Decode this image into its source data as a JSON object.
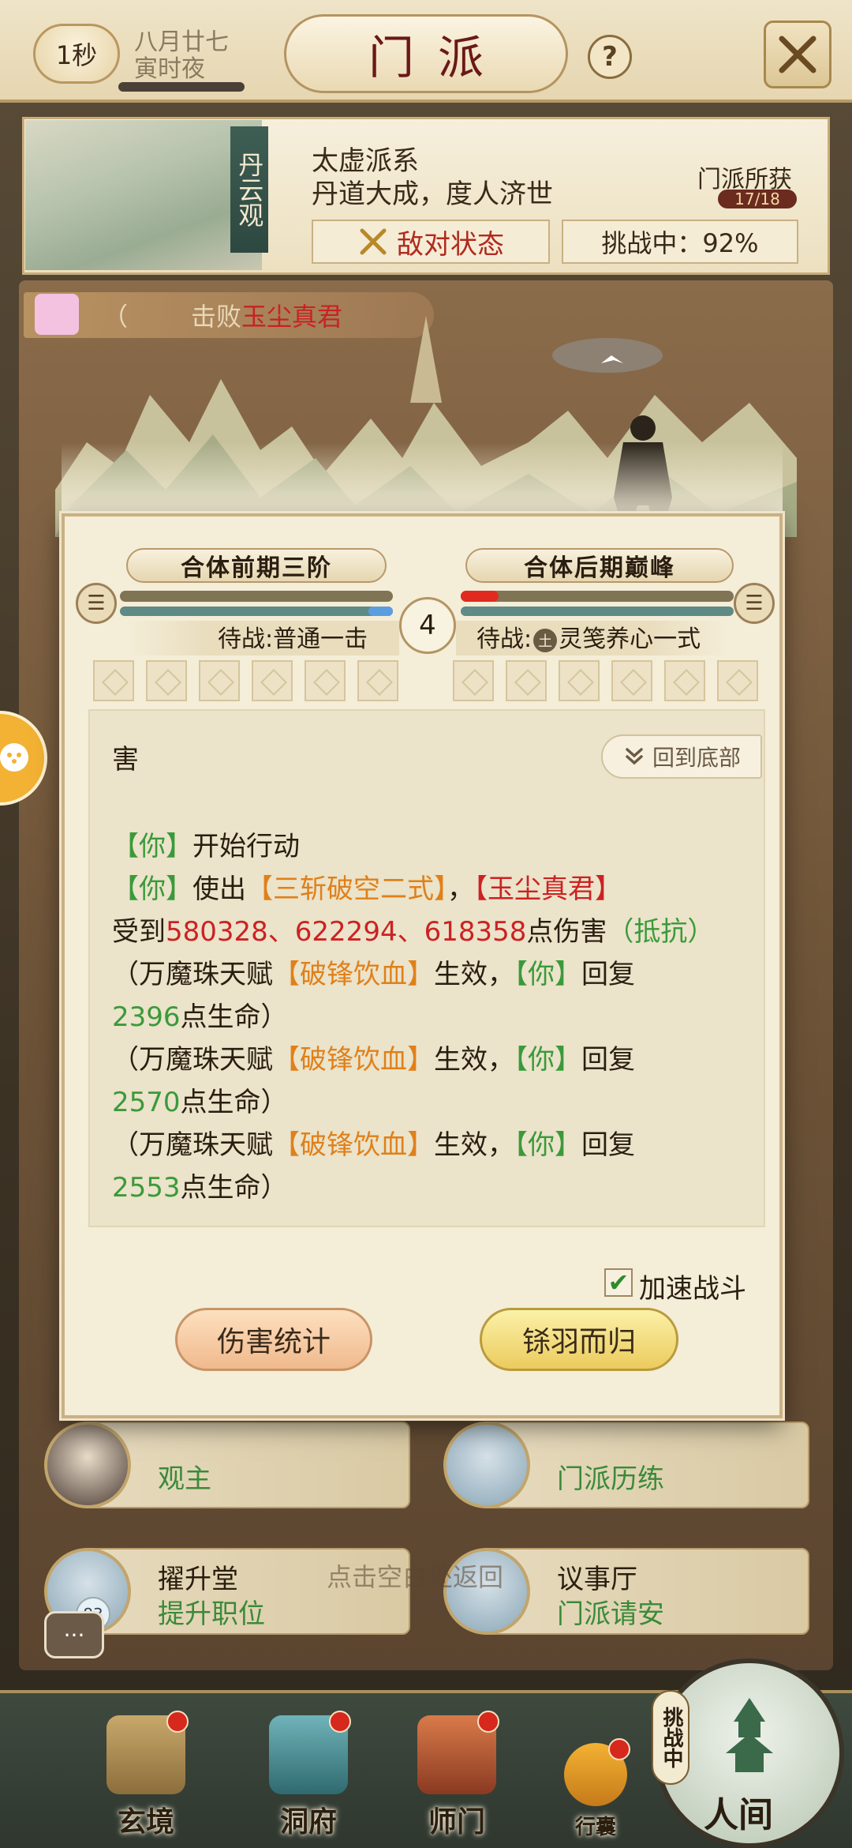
{
  "header": {
    "timer": "1秒",
    "date_line1": "八月廿七",
    "date_line2": "寅时夜",
    "title": "门派",
    "help": "?"
  },
  "sect": {
    "tag": "丹云观",
    "name": "太虚派系",
    "motto": "丹道大成，度人济世",
    "hostile_status": "敌对状态",
    "challenge_status": "挑战中：92%",
    "gain_label": "门派所获",
    "gain_progress": "17/18"
  },
  "defeat_banner": {
    "prefix": "（",
    "visible_mid": "击败",
    "boss": "玉尘真君"
  },
  "battle": {
    "left_realm": "合体前期三阶",
    "right_realm": "合体后期巅峰",
    "round": "4",
    "left_wait": "待战:普通一击",
    "right_wait_prefix": "待战:",
    "right_element": "土",
    "right_wait_skill": "灵笺养心一式",
    "back_to_bottom": "回到底部",
    "speed_label": "加速战斗",
    "speed_checked": true,
    "btn_damage_stats": "伤害统计",
    "btn_retreat": "铩羽而归",
    "hp_right_fraction": 0.14,
    "mp_left_fraction": 0.09
  },
  "log": {
    "line0": "害",
    "you": "【你】",
    "start_action": "开始行动",
    "use": "使出",
    "skill": "【三斩破空二式】",
    "comma": "，",
    "enemy": "【玉尘真君】",
    "received": "受到",
    "damages": "580328、622294、618358",
    "damage_suffix": "点伤害",
    "resist": "（抵抗）",
    "talent_prefix": "（万魔珠天赋",
    "talent": "【破锋饮血】",
    "talent_effect": "生效，",
    "recover": "回复",
    "heal1": "2396",
    "heal2": "2570",
    "heal3": "2553",
    "hp_suffix": "点生命）"
  },
  "buildings": [
    {
      "title": "",
      "subtitle": "观主"
    },
    {
      "title": "",
      "subtitle": "门派历练"
    },
    {
      "title": "擢升堂",
      "subtitle": "提升职位"
    },
    {
      "title": "议事厅",
      "subtitle": "门派请安"
    }
  ],
  "hint": "点击空白处返回",
  "badge_count": "83",
  "nav": {
    "items": [
      "玄境",
      "洞府",
      "师门",
      "行囊"
    ],
    "world": "人间",
    "challenging": "挑战中"
  },
  "colors": {
    "accent_red": "#cc2222",
    "heal_green": "#3a9a3a",
    "skill_orange": "#e0801a"
  }
}
